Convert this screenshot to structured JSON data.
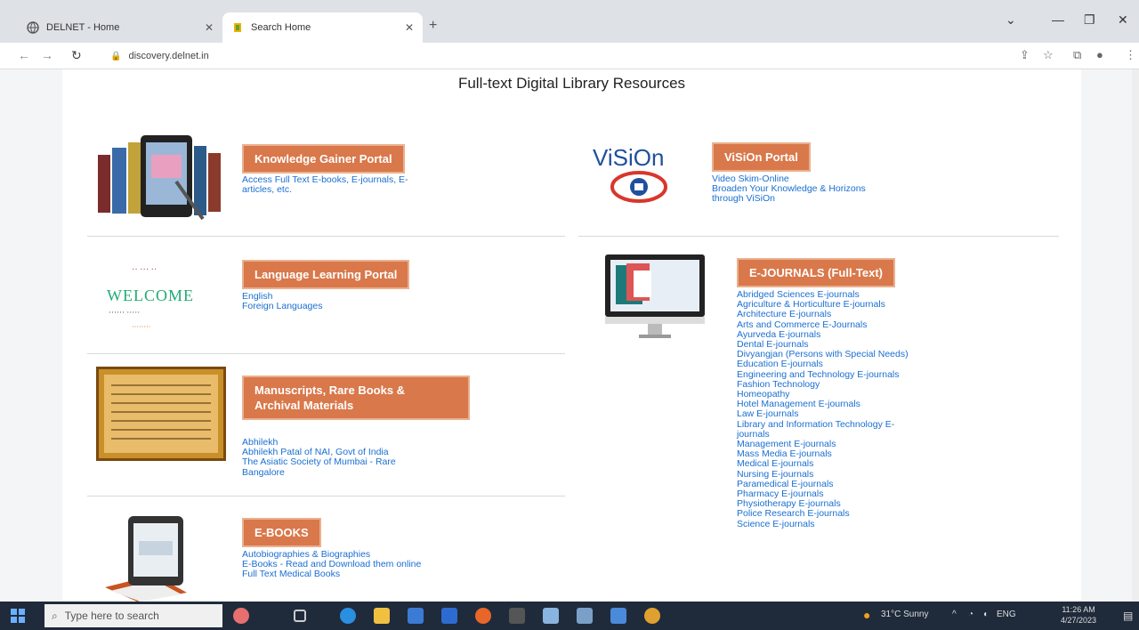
{
  "browser": {
    "tabs": [
      {
        "title": "DELNET - Home"
      },
      {
        "title": "Search Home"
      }
    ],
    "new_tab": "+",
    "url": "discovery.delnet.in",
    "window_controls": {
      "minimize": "—",
      "maximize": "❐",
      "close": "✕"
    }
  },
  "page": {
    "title": "Full-text Digital Library Resources"
  },
  "cards": {
    "knowledge": {
      "badge": "Knowledge Gainer Portal",
      "links": [
        "Access Full Text E-books, E-journals, E-",
        "articles, etc."
      ]
    },
    "vision": {
      "logo_text": "ViSiOn",
      "badge": "ViSiOn Portal",
      "links": [
        "Video Skim-Online",
        "Broaden Your Knowledge & Horizons",
        "through ViSiOn"
      ]
    },
    "language": {
      "logo_text": "WELCOME",
      "badge": "Language Learning Portal",
      "links": [
        "English",
        "Foreign Languages"
      ]
    },
    "ejournals": {
      "badge": "E-JOURNALS (Full-Text)",
      "links": [
        "Abridged Sciences E-journals",
        "Agriculture & Horticulture E-journals",
        "Architecture E-journals",
        "Arts and Commerce E-Journals",
        "Ayurveda E-journals",
        "Dental E-journals",
        "Divyangjan (Persons with Special Needs)",
        "Education E-journals",
        "Engineering and Technology E-journals",
        "Fashion Technology",
        "Homeopathy",
        "Hotel Management E-journals",
        "Law E-journals",
        "Library and Information Technology E-",
        "journals",
        "Management E-journals",
        "Mass Media E-journals",
        "Medical E-journals",
        "Nursing E-journals",
        "Paramedical E-journals",
        "Pharmacy E-journals",
        "Physiotherapy E-journals",
        "Police Research E-journals",
        "Science E-journals"
      ]
    },
    "manuscripts": {
      "badge_line1": "Manuscripts, Rare Books &",
      "badge_line2": "Archival Materials",
      "links": [
        "Abhilekh",
        "Abhilekh Patal of NAI, Govt of India",
        "The Asiatic Society of Mumbai - Rare",
        "Bangalore"
      ]
    },
    "ebooks": {
      "badge": "E-BOOKS",
      "links": [
        "Autobiographies & Biographies",
        "E-Books - Read and Download them online",
        "Full Text Medical Books"
      ]
    }
  },
  "taskbar": {
    "search_placeholder": "Type here to search",
    "weather": "31°C Sunny",
    "time": "11:26 AM",
    "date": "4/27/2023"
  },
  "colors": {
    "badge": "#d9784a",
    "link": "#1a6fd1",
    "taskbar": "#1f2b3b"
  }
}
